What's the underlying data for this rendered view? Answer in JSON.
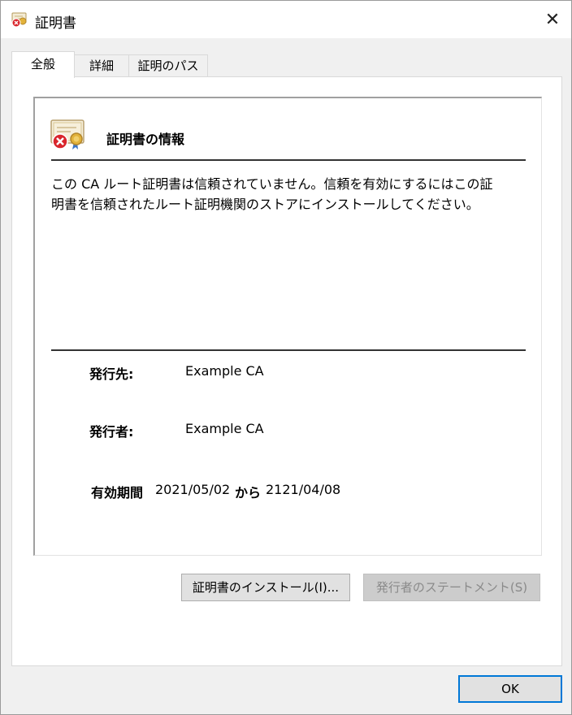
{
  "window": {
    "title": "証明書",
    "title_icon": "certificate-error-icon",
    "close_label": "✕"
  },
  "tabs": [
    {
      "label": "全般",
      "active": true
    },
    {
      "label": "詳細",
      "active": false
    },
    {
      "label": "証明のパス",
      "active": false
    }
  ],
  "info": {
    "icon": "certificate-error-icon",
    "heading": "証明書の情報",
    "message_line1": "この CA ルート証明書は信頼されていません。信頼を有効にするにはこの証",
    "message_line2": "明書を信頼されたルート証明機関のストアにインストールしてください。",
    "issued_to_label": "発行先:",
    "issued_to_value": "Example CA",
    "issued_by_label": "発行者:",
    "issued_by_value": "Example CA",
    "validity_label": "有効期間",
    "valid_from": "2021/05/02",
    "from_to": "から",
    "valid_to": "2121/04/08"
  },
  "buttons": {
    "install": "証明書のインストール(I)...",
    "issuer_statement": "発行者のステートメント(S)",
    "ok": "OK"
  },
  "colors": {
    "accent": "#0078d7",
    "error_red": "#d9262c",
    "certificate_gold": "#e2b23a"
  }
}
